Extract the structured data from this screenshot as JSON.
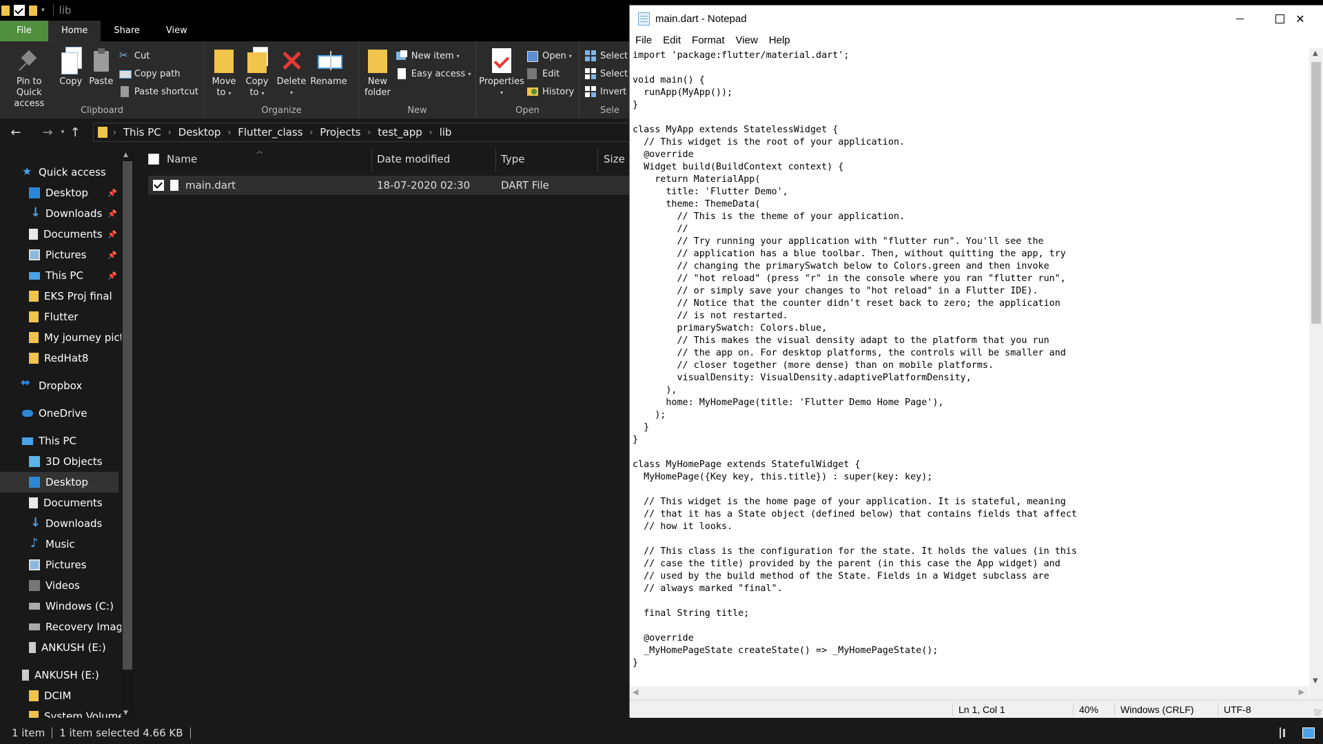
{
  "explorer": {
    "window_title": "lib",
    "ribbon_tabs": [
      "File",
      "Home",
      "Share",
      "View"
    ],
    "clipboard": {
      "pin_label_1": "Pin to Quick",
      "pin_label_2": "access",
      "copy": "Copy",
      "paste": "Paste",
      "cut": "Cut",
      "copy_path": "Copy path",
      "paste_shortcut": "Paste shortcut",
      "group": "Clipboard"
    },
    "organize": {
      "move_to_1": "Move",
      "move_to_2": "to",
      "copy_to_1": "Copy",
      "copy_to_2": "to",
      "delete": "Delete",
      "rename": "Rename",
      "group": "Organize"
    },
    "new": {
      "new_folder_1": "New",
      "new_folder_2": "folder",
      "new_item": "New item",
      "easy_access": "Easy access",
      "group": "New"
    },
    "open": {
      "properties": "Properties",
      "open": "Open",
      "edit": "Edit",
      "history": "History",
      "group": "Open"
    },
    "select": {
      "select_all": "Select",
      "select_none": "Select",
      "invert": "Invert",
      "group": "Sele"
    },
    "breadcrumb": [
      "This PC",
      "Desktop",
      "Flutter_class",
      "Projects",
      "test_app",
      "lib"
    ],
    "nav": {
      "quick_access": "Quick access",
      "qa_desktop": "Desktop",
      "qa_downloads": "Downloads",
      "qa_documents": "Documents",
      "qa_pictures": "Pictures",
      "qa_thispc": "This PC",
      "eks": "EKS Proj final",
      "flutter": "Flutter",
      "journey": "My journey pictu",
      "redhat": "RedHat8",
      "dropbox": "Dropbox",
      "onedrive": "OneDrive",
      "this_pc": "This PC",
      "objects3d": "3D Objects",
      "desktop": "Desktop",
      "documents": "Documents",
      "downloads": "Downloads",
      "music": "Music",
      "pictures": "Pictures",
      "videos": "Videos",
      "windows_c": "Windows (C:)",
      "recovery": "Recovery Image",
      "ankush_1": "ANKUSH (E:)",
      "ankush_2": "ANKUSH (E:)",
      "dcim": "DCIM",
      "system_volume": "System Volume I"
    },
    "columns": {
      "name": "Name",
      "date": "Date modified",
      "type": "Type",
      "size": "Size"
    },
    "files": [
      {
        "name": "main.dart",
        "date": "18-07-2020 02:30",
        "type": "DART File"
      }
    ],
    "status": {
      "count": "1 item",
      "selected": "1 item selected  4.66 KB"
    }
  },
  "notepad": {
    "title": "main.dart - Notepad",
    "menu": [
      "File",
      "Edit",
      "Format",
      "View",
      "Help"
    ],
    "content": "import 'package:flutter/material.dart';\n\nvoid main() {\n  runApp(MyApp());\n}\n\nclass MyApp extends StatelessWidget {\n  // This widget is the root of your application.\n  @override\n  Widget build(BuildContext context) {\n    return MaterialApp(\n      title: 'Flutter Demo',\n      theme: ThemeData(\n        // This is the theme of your application.\n        //\n        // Try running your application with \"flutter run\". You'll see the\n        // application has a blue toolbar. Then, without quitting the app, try\n        // changing the primarySwatch below to Colors.green and then invoke\n        // \"hot reload\" (press \"r\" in the console where you ran \"flutter run\",\n        // or simply save your changes to \"hot reload\" in a Flutter IDE).\n        // Notice that the counter didn't reset back to zero; the application\n        // is not restarted.\n        primarySwatch: Colors.blue,\n        // This makes the visual density adapt to the platform that you run\n        // the app on. For desktop platforms, the controls will be smaller and\n        // closer together (more dense) than on mobile platforms.\n        visualDensity: VisualDensity.adaptivePlatformDensity,\n      ),\n      home: MyHomePage(title: 'Flutter Demo Home Page'),\n    );\n  }\n}\n\nclass MyHomePage extends StatefulWidget {\n  MyHomePage({Key key, this.title}) : super(key: key);\n\n  // This widget is the home page of your application. It is stateful, meaning\n  // that it has a State object (defined below) that contains fields that affect\n  // how it looks.\n\n  // This class is the configuration for the state. It holds the values (in this\n  // case the title) provided by the parent (in this case the App widget) and\n  // used by the build method of the State. Fields in a Widget subclass are\n  // always marked \"final\".\n\n  final String title;\n\n  @override\n  _MyHomePageState createState() => _MyHomePageState();\n}",
    "status": {
      "position": "Ln 1, Col 1",
      "zoom": "40%",
      "line_endings": "Windows (CRLF)",
      "encoding": "UTF-8"
    }
  },
  "colors": {
    "file_tab": "#4f8f3e",
    "folder": "#f0c34b",
    "accent": "#2b88d8"
  }
}
